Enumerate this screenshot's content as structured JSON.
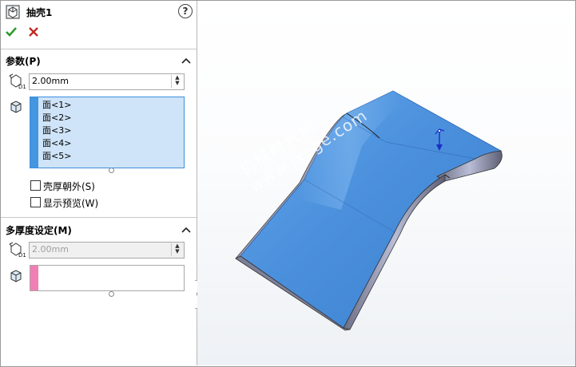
{
  "feature": {
    "title": "抽壳1",
    "help_icon": "help-icon",
    "ok_icon": "check-icon",
    "cancel_icon": "close-icon"
  },
  "params": {
    "header": "参数(P)",
    "thickness": "2.00mm",
    "faces": [
      "面<1>",
      "面<2>",
      "面<3>",
      "面<4>",
      "面<5>"
    ],
    "outward_label": "壳厚朝外(S)",
    "outward_checked": false,
    "preview_label": "显示预览(W)",
    "preview_checked": false
  },
  "multi": {
    "header": "多厚度设定(M)",
    "thickness": "2.00mm",
    "faces": []
  },
  "watermark": {
    "line1": "机械时代网",
    "line2": "www.jxage.com"
  },
  "colors": {
    "accent": "#3b8ede",
    "list_bg": "#cfe4f8",
    "multi_strip": "#f07fb4",
    "model_face": "#4a8fdc",
    "model_edge": "#8f94b4"
  }
}
